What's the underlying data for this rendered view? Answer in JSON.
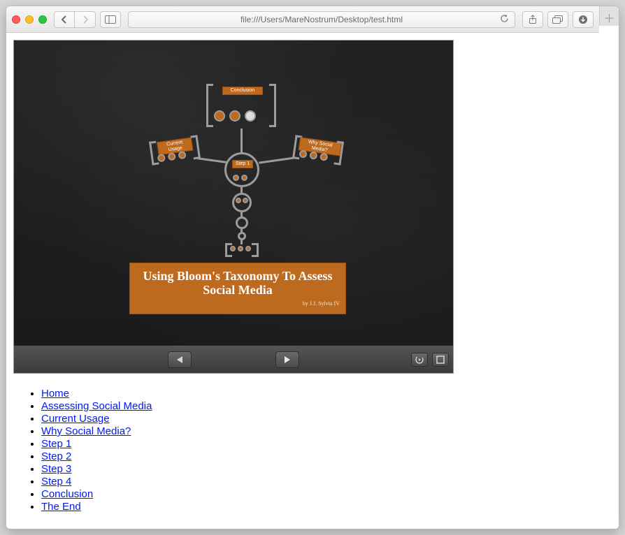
{
  "browser": {
    "url": "file:///Users/MareNostrum/Desktop/test.html"
  },
  "prezi": {
    "title": "Using Bloom's Taxonomy To Assess Social Media",
    "byline": "by J.J. Sylvia IV",
    "nodes": {
      "top_label": "Conclusion",
      "left_label": "Current Usage",
      "right_label": "Why Social Media?",
      "center_label": "Step 1"
    }
  },
  "nav_links": [
    "Home",
    "Assessing Social Media",
    "Current Usage",
    "Why Social Media?",
    "Step 1",
    "Step 2",
    "Step 3",
    "Step 4",
    "Conclusion",
    "The End"
  ]
}
